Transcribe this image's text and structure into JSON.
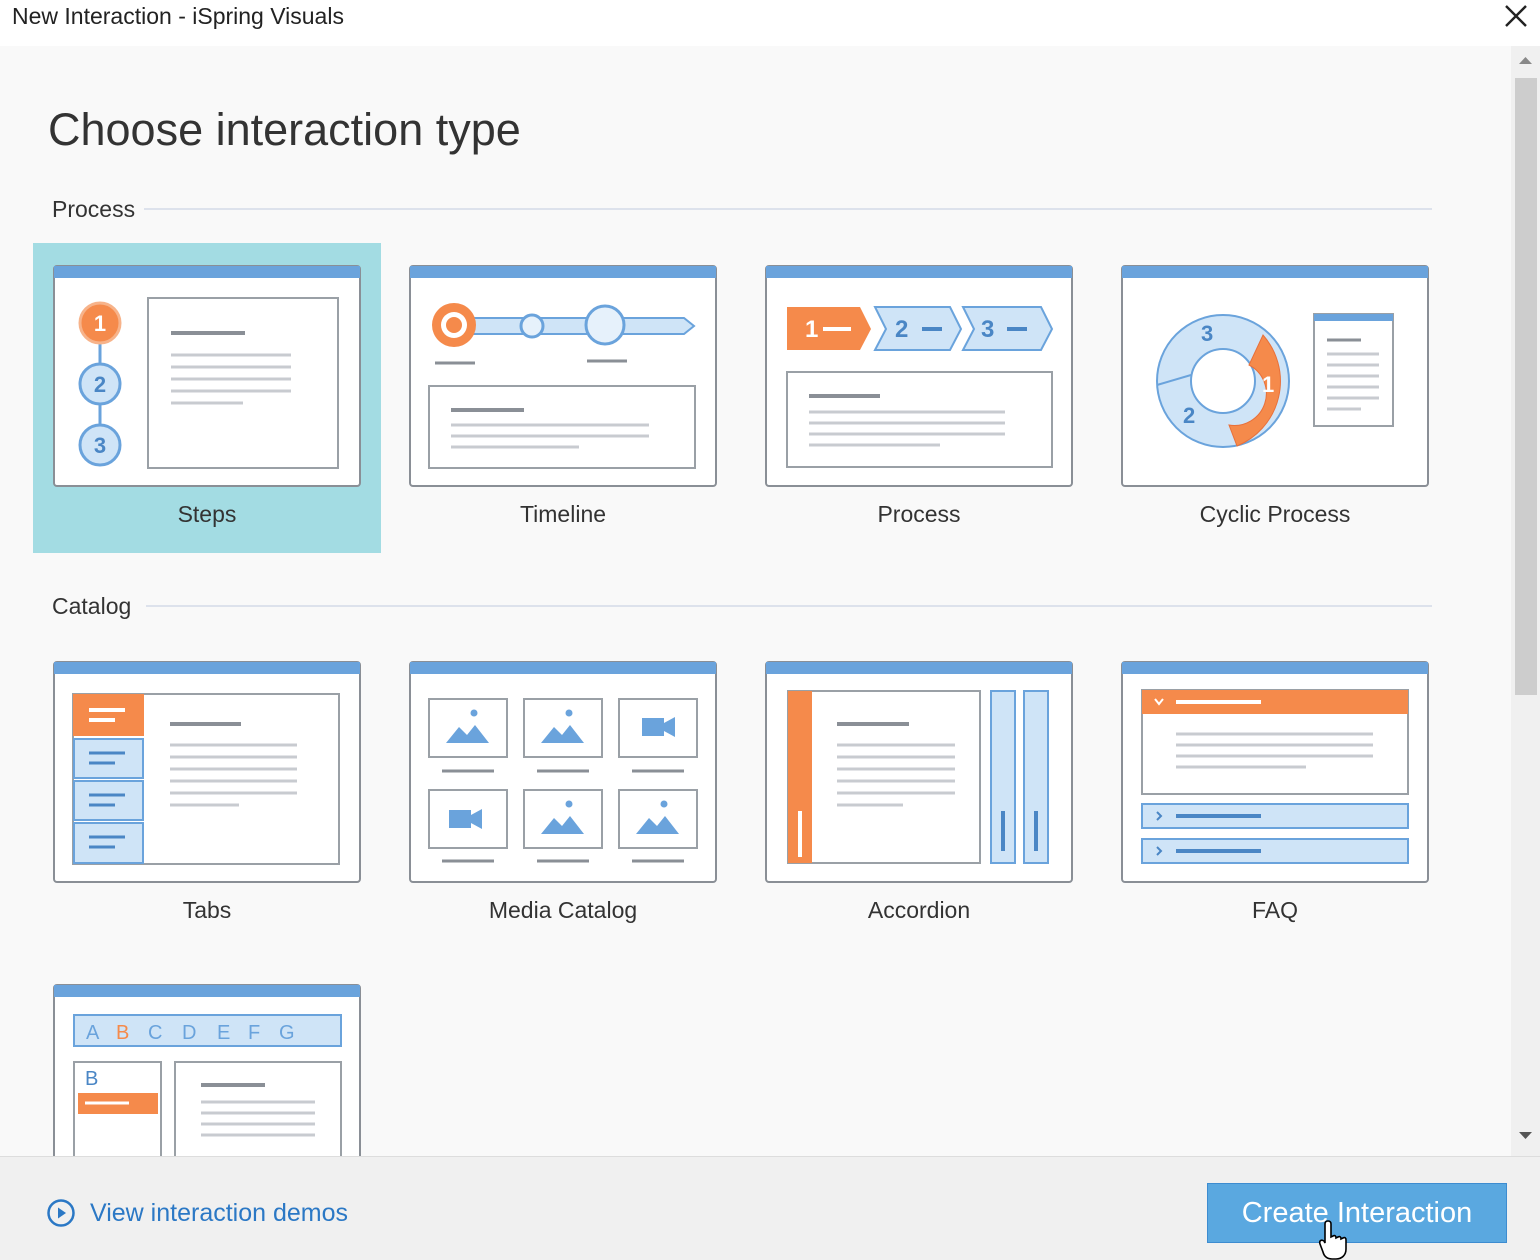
{
  "window": {
    "title": "New Interaction - iSpring Visuals"
  },
  "heading": "Choose interaction type",
  "sections": [
    {
      "label": "Process",
      "items": [
        "Steps",
        "Timeline",
        "Process",
        "Cyclic Process"
      ]
    },
    {
      "label": "Catalog",
      "items": [
        "Tabs",
        "Media Catalog",
        "Accordion",
        "FAQ"
      ]
    }
  ],
  "selected_item": "Steps",
  "thumb_text": {
    "steps": [
      "1",
      "2",
      "3"
    ],
    "process": [
      "1",
      "2",
      "3"
    ],
    "cyclic": [
      "3",
      "2",
      "1"
    ],
    "glossary_letters": [
      "A",
      "B",
      "C",
      "D",
      "E",
      "F",
      "G"
    ],
    "glossary_selected": "B"
  },
  "footer": {
    "demo_link": "View interaction demos",
    "create_button": "Create Interaction"
  },
  "colors": {
    "accent_orange": "#f58a4b",
    "accent_blue": "#6aa3dc",
    "light_blue": "#cfe4f7",
    "selection": "#a3dce3",
    "link": "#2b78c5",
    "button": "#5aa8e0"
  }
}
